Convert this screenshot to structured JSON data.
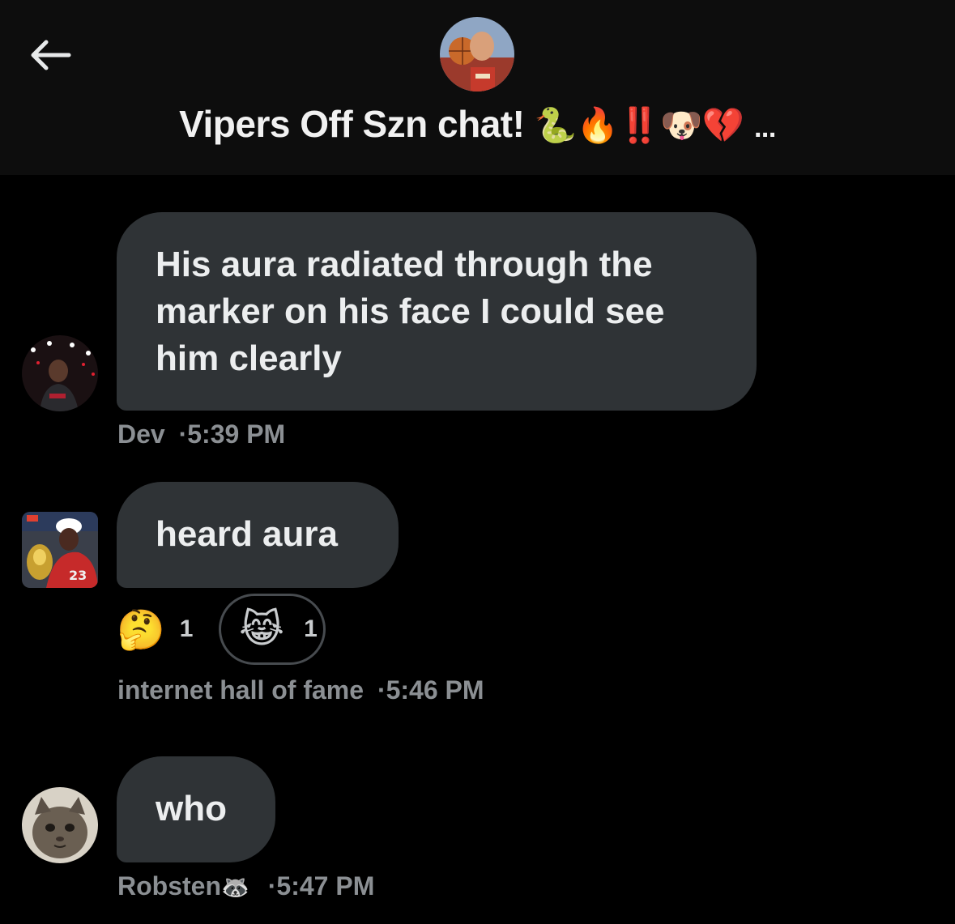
{
  "header": {
    "title": "Vipers Off Szn chat!",
    "title_emojis": "🐍🔥‼️🐶💔",
    "title_ellipsis": "..."
  },
  "messages": [
    {
      "text": "His aura radiated through the marker on his face I could see him clearly",
      "sender": "Dev",
      "time": "·5:39 PM"
    },
    {
      "text": "heard aura",
      "sender": "internet hall of fame",
      "time": "·5:46 PM",
      "reactions": [
        {
          "emoji": "🤔",
          "count": "1"
        },
        {
          "emoji": "😹",
          "count": "1"
        }
      ]
    },
    {
      "text": "who",
      "sender": "Robsten",
      "sender_emoji": "🦝",
      "time": "·5:47 PM"
    }
  ],
  "colors": {
    "background": "#000000",
    "header_background": "#0d0d0d",
    "bubble": "#2f3336",
    "meta_text": "#8b8f93"
  }
}
